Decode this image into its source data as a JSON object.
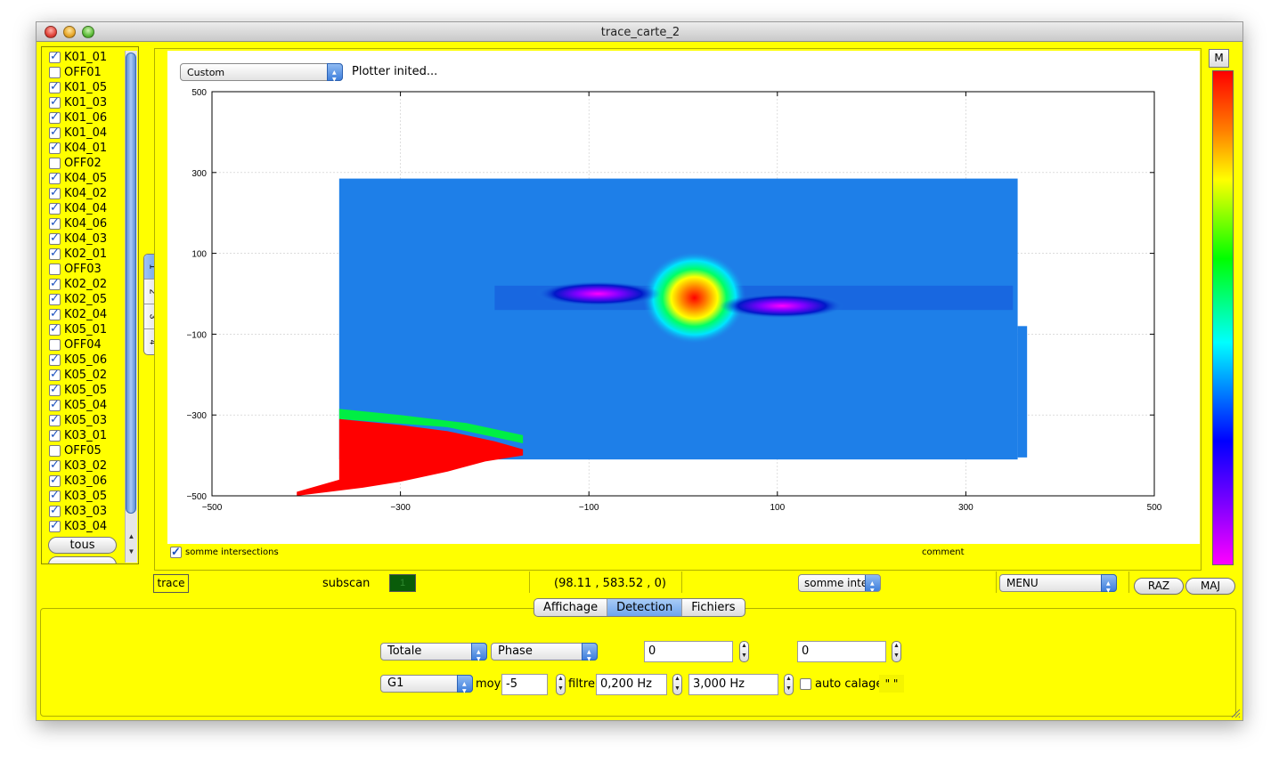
{
  "window": {
    "title": "trace_carte_2"
  },
  "channels": [
    {
      "label": "K01_01",
      "checked": true
    },
    {
      "label": "OFF01",
      "checked": false
    },
    {
      "label": "K01_05",
      "checked": true
    },
    {
      "label": "K01_03",
      "checked": true
    },
    {
      "label": "K01_06",
      "checked": true
    },
    {
      "label": "K01_04",
      "checked": true
    },
    {
      "label": "K04_01",
      "checked": true
    },
    {
      "label": "OFF02",
      "checked": false
    },
    {
      "label": "K04_05",
      "checked": true
    },
    {
      "label": "K04_02",
      "checked": true
    },
    {
      "label": "K04_04",
      "checked": true
    },
    {
      "label": "K04_06",
      "checked": true
    },
    {
      "label": "K04_03",
      "checked": true
    },
    {
      "label": "K02_01",
      "checked": true
    },
    {
      "label": "OFF03",
      "checked": false
    },
    {
      "label": "K02_02",
      "checked": true
    },
    {
      "label": "K02_05",
      "checked": true
    },
    {
      "label": "K02_04",
      "checked": true
    },
    {
      "label": "K05_01",
      "checked": true
    },
    {
      "label": "OFF04",
      "checked": false
    },
    {
      "label": "K05_06",
      "checked": true
    },
    {
      "label": "K05_02",
      "checked": true
    },
    {
      "label": "K05_05",
      "checked": true
    },
    {
      "label": "K05_04",
      "checked": true
    },
    {
      "label": "K05_03",
      "checked": true
    },
    {
      "label": "K03_01",
      "checked": true
    },
    {
      "label": "OFF05",
      "checked": false
    },
    {
      "label": "K03_02",
      "checked": true
    },
    {
      "label": "K03_06",
      "checked": true
    },
    {
      "label": "K03_05",
      "checked": true
    },
    {
      "label": "K03_03",
      "checked": true
    },
    {
      "label": "K03_04",
      "checked": true
    }
  ],
  "list": {
    "tous_label": "tous"
  },
  "vtabs": [
    "1",
    "2",
    "3",
    "4"
  ],
  "plot": {
    "mode_combo": "Custom",
    "status": "Plotter inited...",
    "somme_label": "somme intersections",
    "comment_label": "comment",
    "colorbar_button": "M"
  },
  "chart_data": {
    "type": "heatmap",
    "title": "",
    "xlabel": "",
    "ylabel": "",
    "xlim": [
      -500,
      500
    ],
    "ylim": [
      -500,
      500
    ],
    "xticks": [
      -500,
      -300,
      -100,
      100,
      300,
      500
    ],
    "yticks": [
      -500,
      -300,
      -100,
      100,
      300,
      500
    ],
    "xtick_labels": [
      "−500",
      "−300",
      "−100",
      "100",
      "300",
      "500"
    ],
    "ytick_labels": [
      "−500",
      "−300",
      "−100",
      "100",
      "300",
      "500"
    ],
    "grid": true,
    "colormap": [
      "#ff0000",
      "#ff7f00",
      "#ffff00",
      "#00ff00",
      "#00ffff",
      "#0000ff",
      "#8000ff",
      "#ff00ff"
    ],
    "map_extent": {
      "x": [
        -365,
        355
      ],
      "y": [
        -410,
        285
      ]
    },
    "map_extent_lower_right": {
      "x": [
        355,
        365
      ],
      "y": [
        -405,
        -80
      ]
    },
    "background_color": "#1e7fe8",
    "features": [
      {
        "kind": "hot-spot",
        "x": 12,
        "y": -10,
        "color": "#ff0000"
      },
      {
        "kind": "cold-spot",
        "x": -90,
        "y": 0,
        "color": "#ff00ff"
      },
      {
        "kind": "cold-spot",
        "x": 105,
        "y": -30,
        "color": "#d400ff"
      },
      {
        "kind": "saturated-region",
        "x": [
          -410,
          -170
        ],
        "y": [
          -500,
          -310
        ],
        "color": "#ff0000"
      }
    ]
  },
  "statusbar": {
    "trace_button": "trace",
    "subscan_label": "subscan",
    "subscan_value": "1",
    "coords": "(98.11 , 583.52 , 0)",
    "somme_combo": "somme inte",
    "menu_combo": "MENU",
    "raz_button": "RAZ",
    "maj_button": "MAJ"
  },
  "tabs": [
    {
      "label": "Affichage",
      "selected": false
    },
    {
      "label": "Detection",
      "selected": true
    },
    {
      "label": "Fichiers",
      "selected": false
    }
  ],
  "detection": {
    "totale_combo": "Totale",
    "phase_combo": "Phase",
    "field1": "0",
    "field2": "0",
    "g1_combo": "G1",
    "moy_label": "moy",
    "moy_value": "-5",
    "filtre_label": "filtre",
    "filtre_low": "0,200 Hz",
    "filtre_high": "3,000 Hz",
    "auto_calage_label": "auto calage",
    "quote_value": "\" \""
  }
}
